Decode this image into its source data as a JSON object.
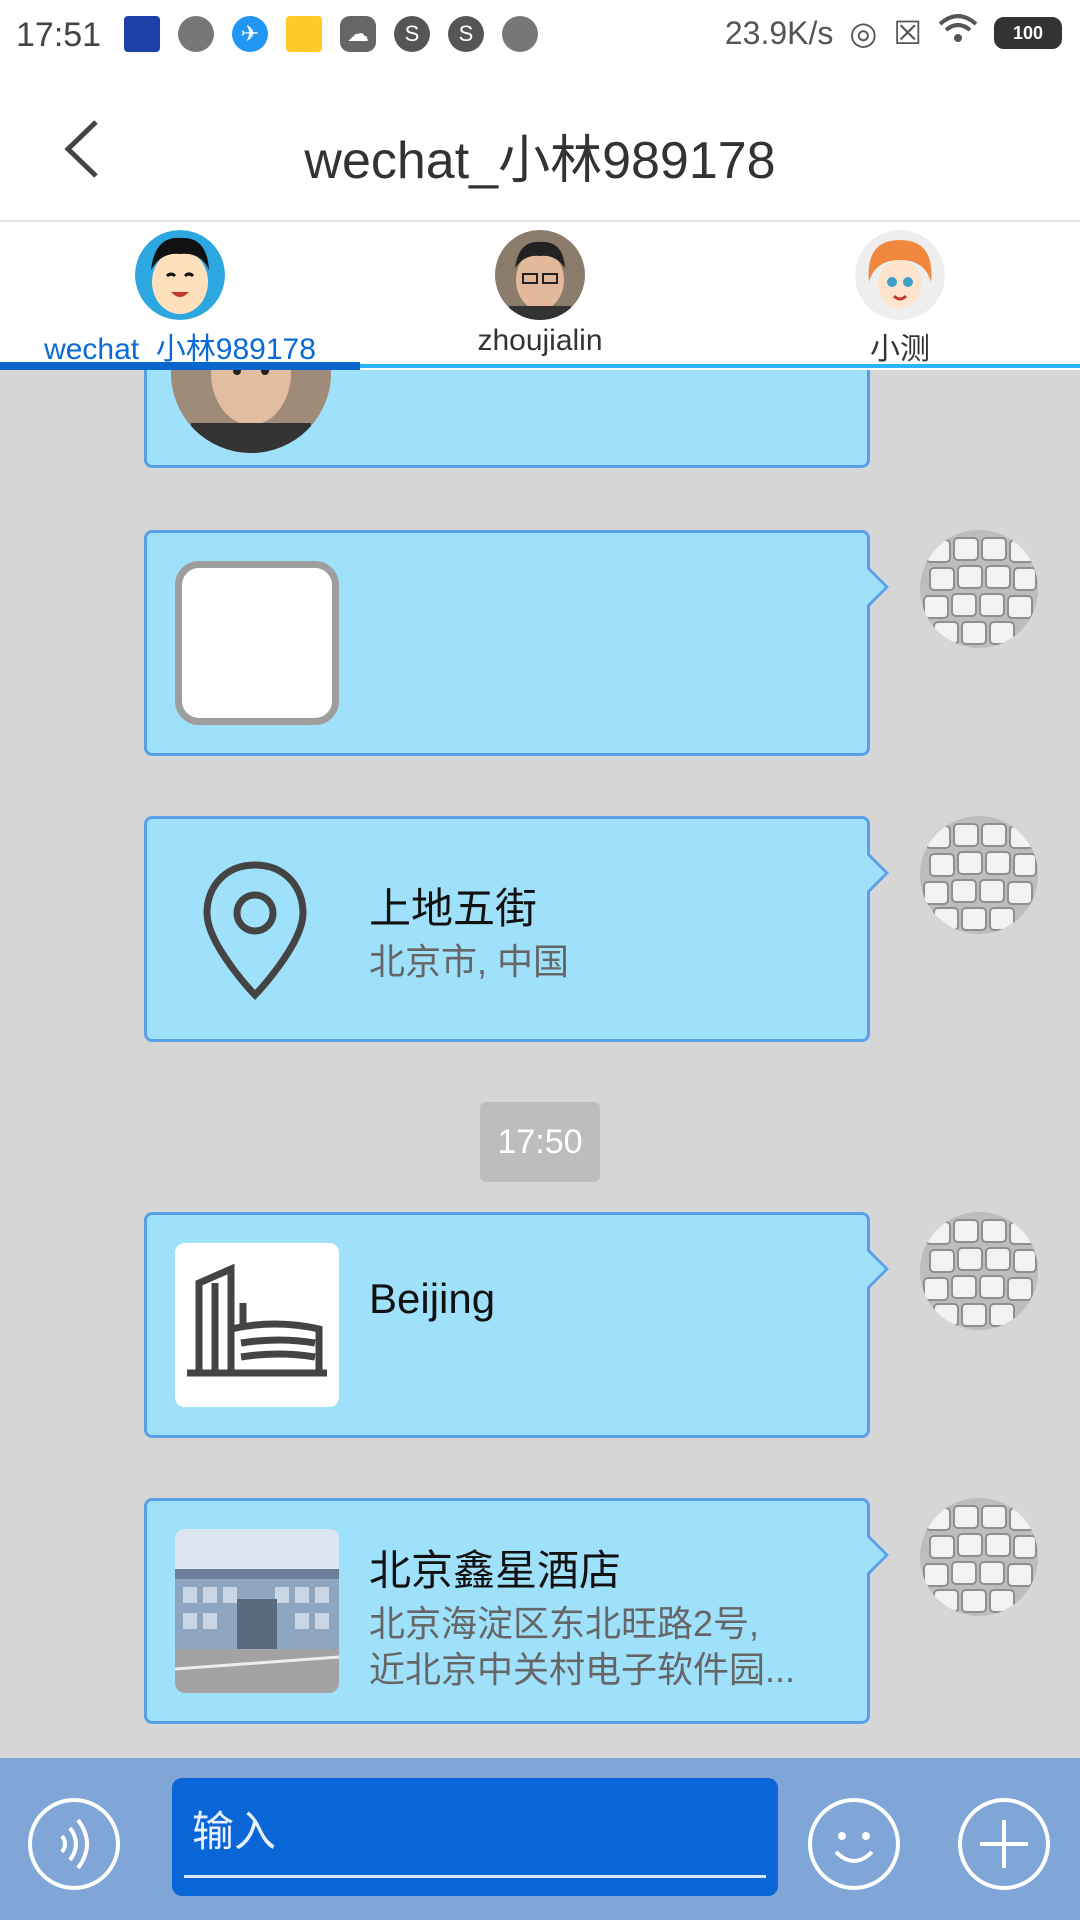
{
  "status_bar": {
    "time": "17:51",
    "network_speed": "23.9K/s",
    "battery": "100"
  },
  "header": {
    "title": "wechat_小林989178"
  },
  "tabs": [
    {
      "label": "wechat_小林989178",
      "active": true
    },
    {
      "label": "zhoujialin",
      "active": false
    },
    {
      "label": "小测",
      "active": false
    }
  ],
  "messages": {
    "location": {
      "title": "上地五街",
      "subtitle": "北京市, 中国"
    },
    "timestamp": "17:50",
    "place": {
      "title": "Beijing"
    },
    "hotel": {
      "title": "北京鑫星酒店",
      "address_line1": "北京海淀区东北旺路2号,",
      "address_line2": "近北京中关村电子软件园..."
    }
  },
  "input": {
    "placeholder": "输入"
  },
  "colors": {
    "bubble": "#9fe1fb",
    "bubble_border": "#5aa0e8",
    "accent": "#0a66cc",
    "input_bar": "#7fa6d6"
  }
}
